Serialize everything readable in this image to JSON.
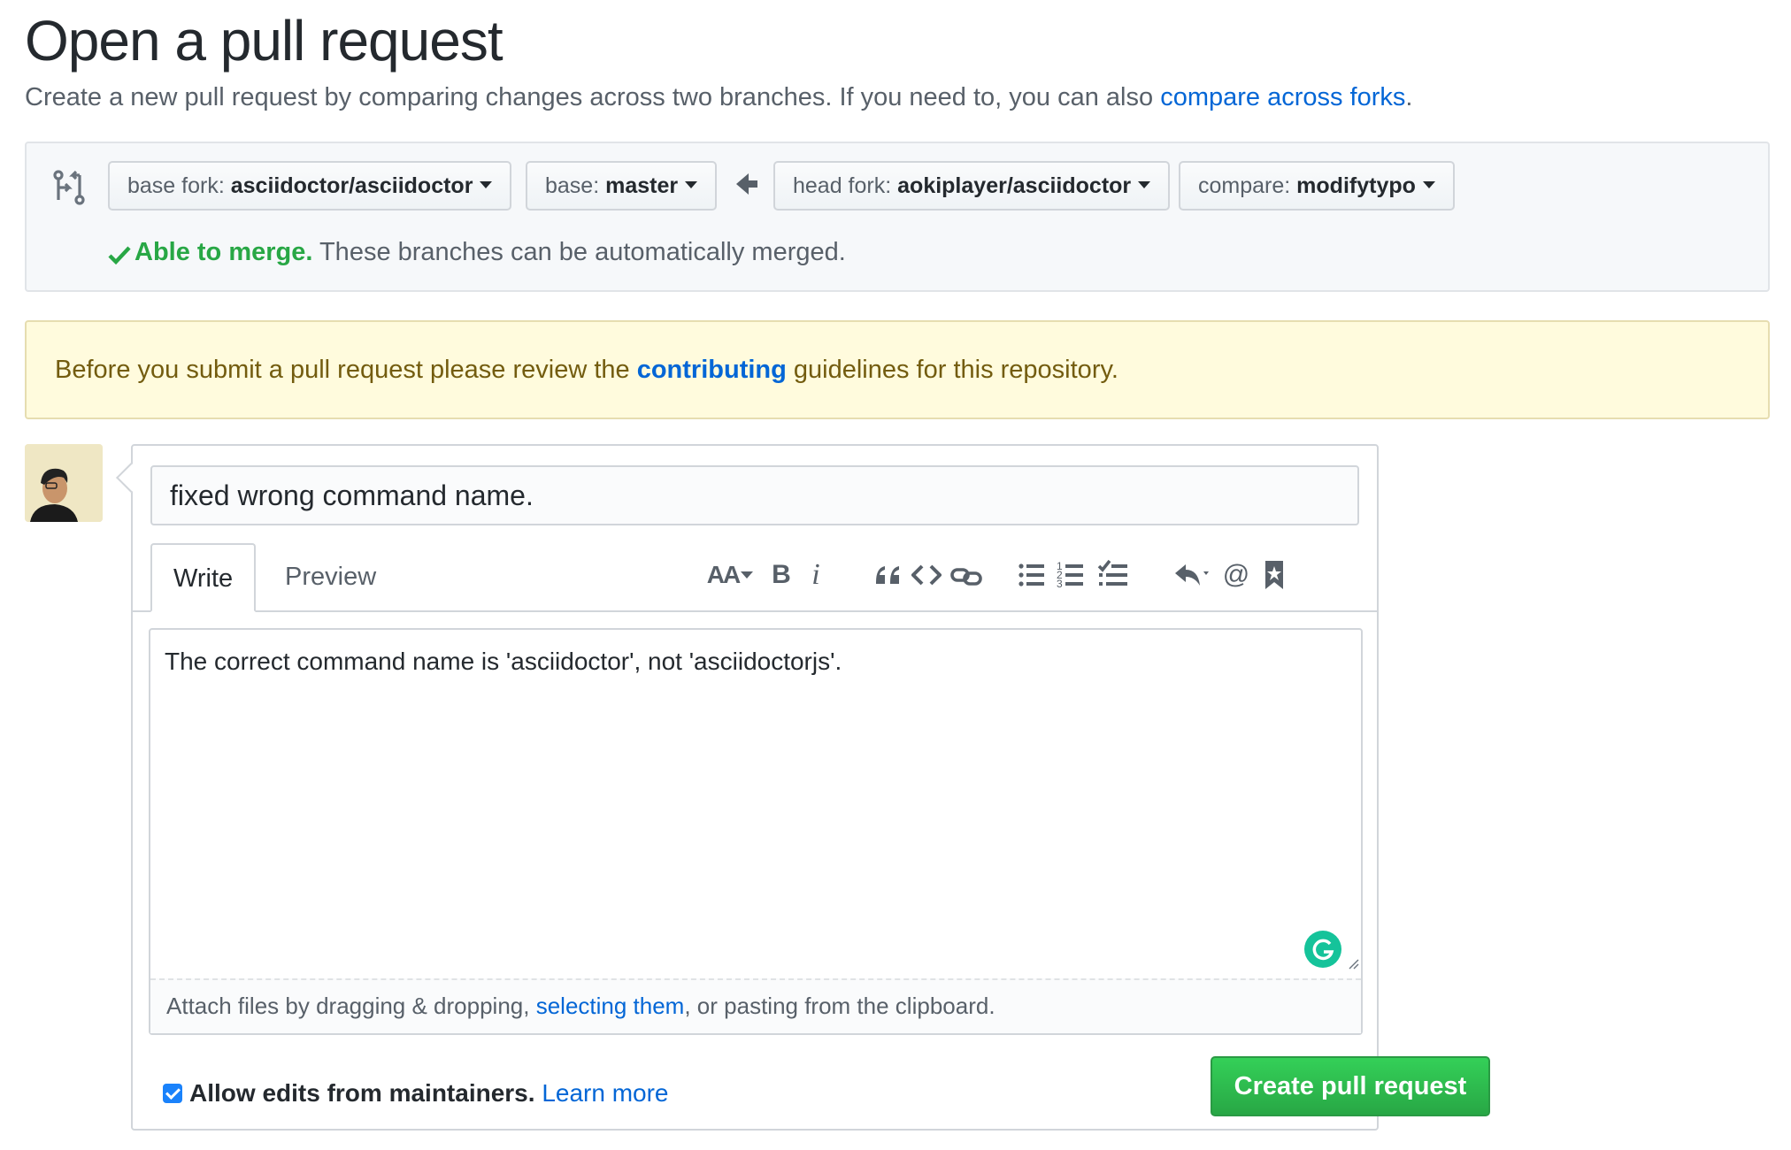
{
  "header": {
    "title": "Open a pull request",
    "subtitle_prefix": "Create a new pull request by comparing changes across two branches. If you need to, you can also ",
    "subtitle_link": "compare across forks",
    "subtitle_suffix": "."
  },
  "range": {
    "base_fork_label": "base fork:",
    "base_fork_value": "asciidoctor/asciidoctor",
    "base_label": "base:",
    "base_value": "master",
    "head_fork_label": "head fork:",
    "head_fork_value": "aokiplayer/asciidoctor",
    "compare_label": "compare:",
    "compare_value": "modifytypo",
    "merge_status": "Able to merge.",
    "merge_message": " These branches can be automatically merged."
  },
  "flash": {
    "prefix": "Before you submit a pull request please review the ",
    "link": "contributing",
    "suffix": " guidelines for this repository."
  },
  "form": {
    "title_value": "fixed wrong command name.",
    "tabs": [
      "Write",
      "Preview"
    ],
    "body_text": "The correct command name is 'asciidoctor', not 'asciidoctorjs'.",
    "attach_prefix": "Attach files by dragging & dropping, ",
    "attach_link": "selecting them",
    "attach_suffix": ", or pasting from the clipboard.",
    "maintainers_label": "Allow edits from maintainers.",
    "maintainers_checked": true,
    "learn_more": "Learn more",
    "submit_label": "Create pull request"
  },
  "toolbar": {
    "header": "AA",
    "bold": "B",
    "italic": "i",
    "icons": [
      "header-icon",
      "bold-icon",
      "italic-icon",
      "quote-icon",
      "code-icon",
      "link-icon",
      "unordered-list-icon",
      "ordered-list-icon",
      "task-list-icon",
      "reply-icon",
      "mention-icon",
      "saved-reply-icon"
    ]
  },
  "colors": {
    "link": "#0366d6",
    "success": "#28a745",
    "flash_bg": "#fffbdd",
    "button_green": "#28a745",
    "checkbox": "#1a82fb"
  }
}
